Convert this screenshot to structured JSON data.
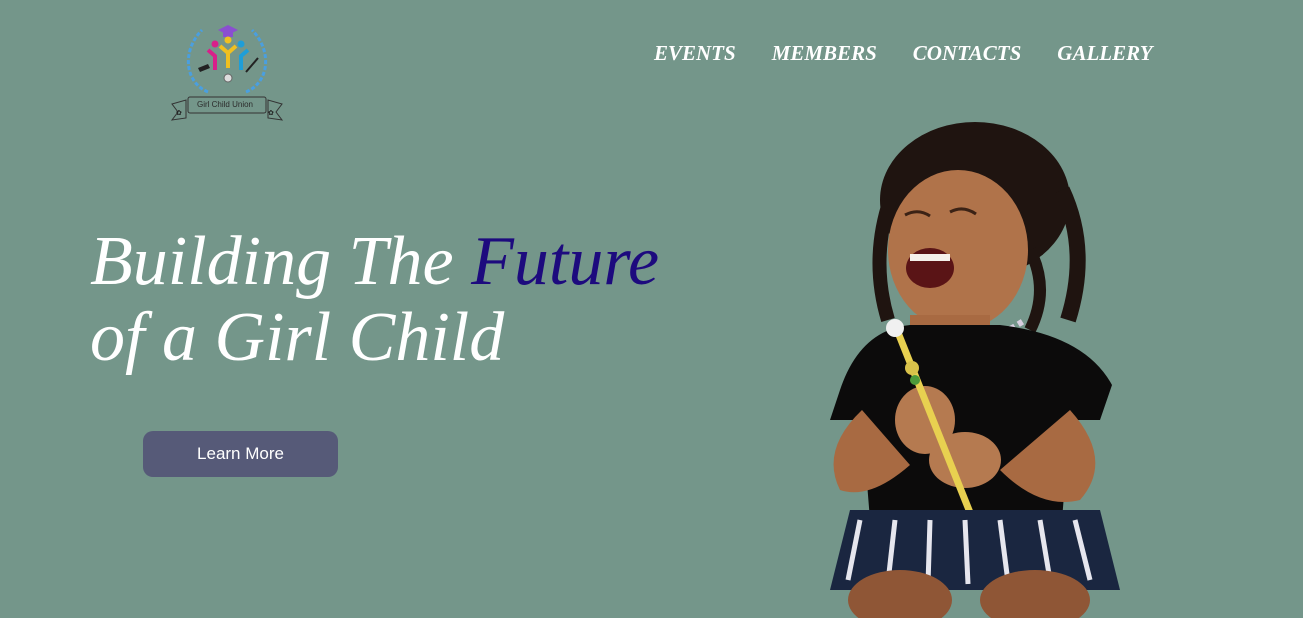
{
  "brand": {
    "logo_text": "Girl Child Union"
  },
  "nav": {
    "items": [
      "EVENTS",
      "MEMBERS",
      "CONTACTS",
      "GALLERY"
    ]
  },
  "hero": {
    "title_line1_prefix": "Building The ",
    "title_line1_accent": "Future",
    "title_line2": "of a Girl Child",
    "cta_label": "Learn More"
  },
  "colors": {
    "background": "#74968a",
    "accent": "#1d0a7e",
    "button": "#565a78"
  }
}
